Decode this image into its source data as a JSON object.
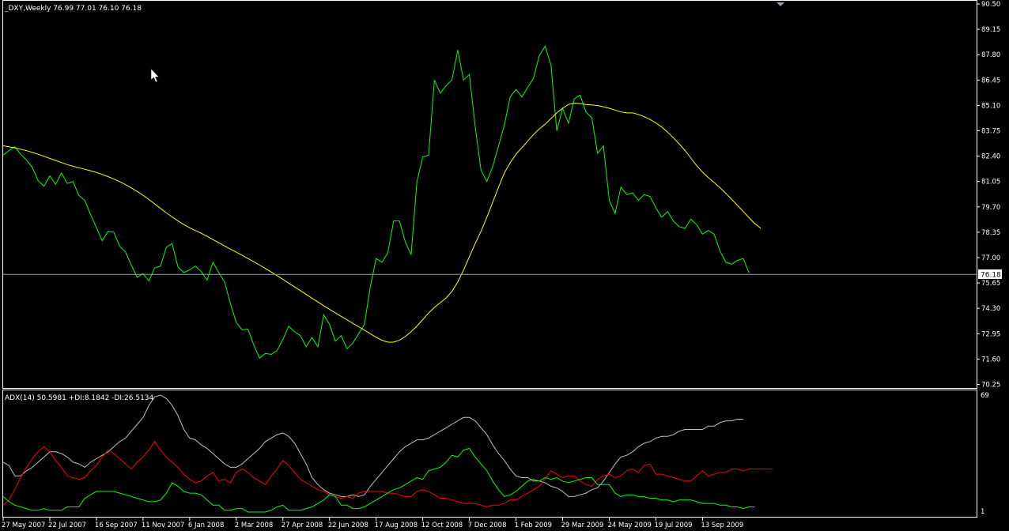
{
  "main_header": "_DXY,Weekly  76.99 77.01 76.10 76.18",
  "sub_header": "ADX(14) 50.5981 +DI:8.1842 -DI:26.5134",
  "current_price_label": "76.18",
  "current_price": 76.18,
  "colors": {
    "background": "#000000",
    "price": "#00ff00",
    "ma": "#ffff00",
    "adx": "#c0c0c0",
    "plus_di": "#00ff00",
    "minus_di": "#ff0000",
    "axis": "#ffffff",
    "price_line": "#8ea0b4"
  },
  "chart_data": [
    {
      "type": "line",
      "title": "_DXY,Weekly",
      "ylim": [
        70.25,
        90.5
      ],
      "y_ticks": [
        "90.50",
        "89.15",
        "87.80",
        "86.45",
        "85.10",
        "83.75",
        "82.40",
        "81.05",
        "79.70",
        "78.35",
        "77.00",
        "75.65",
        "74.30",
        "72.95",
        "71.60",
        "70.25"
      ],
      "series": [
        {
          "name": "_DXY",
          "values": [
            82.45,
            82.7,
            82.9,
            82.5,
            82.2,
            81.8,
            81.1,
            80.8,
            81.35,
            80.9,
            81.5,
            80.95,
            81.05,
            80.3,
            80.05,
            79.3,
            78.6,
            77.9,
            78.4,
            78.35,
            77.6,
            77.3,
            76.6,
            75.95,
            76.15,
            75.75,
            76.45,
            76.55,
            77.55,
            77.75,
            76.5,
            76.2,
            76.35,
            76.55,
            76.25,
            75.8,
            76.75,
            76.2,
            75.7,
            74.55,
            73.55,
            73.15,
            73.2,
            72.35,
            71.65,
            71.9,
            71.85,
            72.05,
            72.65,
            73.35,
            73.05,
            72.85,
            72.25,
            72.75,
            72.25,
            73.95,
            73.45,
            72.55,
            72.85,
            72.15,
            72.45,
            72.95,
            73.45,
            75.45,
            76.95,
            76.75,
            77.25,
            78.95,
            78.95,
            77.85,
            77.15,
            81.05,
            82.35,
            82.45,
            86.45,
            85.75,
            86.15,
            86.45,
            88.05,
            86.45,
            86.75,
            83.95,
            81.65,
            81.05,
            81.85,
            82.95,
            84.05,
            85.55,
            85.95,
            85.55,
            86.05,
            86.55,
            87.75,
            88.25,
            87.25,
            83.75,
            84.95,
            84.15,
            85.45,
            85.65,
            84.75,
            84.45,
            82.55,
            82.95,
            80.05,
            79.35,
            80.75,
            80.35,
            80.45,
            80.05,
            80.35,
            80.25,
            79.65,
            79.15,
            79.45,
            78.95,
            78.65,
            78.55,
            79.05,
            78.75,
            78.25,
            78.45,
            78.25,
            77.35,
            76.75,
            76.65,
            76.85,
            76.95,
            76.18
          ]
        },
        {
          "name": "MA",
          "values": [
            82.95,
            82.9,
            82.84,
            82.77,
            82.69,
            82.6,
            82.5,
            82.39,
            82.28,
            82.17,
            82.06,
            81.95,
            81.86,
            81.78,
            81.7,
            81.62,
            81.53,
            81.43,
            81.31,
            81.18,
            81.04,
            80.88,
            80.71,
            80.52,
            80.32,
            80.09,
            79.86,
            79.62,
            79.38,
            79.16,
            78.95,
            78.76,
            78.59,
            78.44,
            78.29,
            78.13,
            77.96,
            77.79,
            77.62,
            77.45,
            77.29,
            77.12,
            76.95,
            76.78,
            76.6,
            76.42,
            76.23,
            76.04,
            75.84,
            75.64,
            75.44,
            75.24,
            75.04,
            74.84,
            74.64,
            74.44,
            74.25,
            74.06,
            73.87,
            73.69,
            73.5,
            73.32,
            73.14,
            72.95,
            72.76,
            72.6,
            72.5,
            72.5,
            72.6,
            72.8,
            73.06,
            73.36,
            73.7,
            74.05,
            74.35,
            74.6,
            74.85,
            75.2,
            75.7,
            76.33,
            77.05,
            77.75,
            78.4,
            79.15,
            79.95,
            80.75,
            81.5,
            82.05,
            82.5,
            82.85,
            83.2,
            83.55,
            83.85,
            84.1,
            84.4,
            84.7,
            84.95,
            85.15,
            85.22,
            85.2,
            85.15,
            85.12,
            85.09,
            85.03,
            84.95,
            84.85,
            84.75,
            84.7,
            84.7,
            84.62,
            84.5,
            84.35,
            84.17,
            83.95,
            83.68,
            83.38,
            83.05,
            82.7,
            82.3,
            81.9,
            81.55,
            81.25,
            81.0,
            80.72,
            80.42,
            80.1,
            79.78,
            79.45,
            79.12,
            78.8,
            78.56
          ]
        }
      ]
    },
    {
      "type": "line",
      "title": "ADX(14)",
      "ylim": [
        1,
        69
      ],
      "y_ticks": [
        "69",
        "1"
      ],
      "series": [
        {
          "name": "ADX",
          "values": [
            30,
            28,
            22,
            22,
            25,
            27,
            30,
            33,
            36,
            36,
            35,
            33,
            30,
            29,
            27,
            30,
            32,
            34,
            36,
            39,
            42,
            44,
            48,
            52,
            56,
            63,
            68,
            69,
            67,
            63,
            57,
            49,
            44,
            43,
            40,
            38,
            35,
            32,
            29,
            27,
            27,
            29,
            32,
            35,
            38,
            42,
            44,
            46,
            47,
            45,
            41,
            35,
            29,
            21,
            17,
            14,
            12,
            11,
            10,
            10,
            11,
            10,
            11,
            16,
            20,
            24,
            28,
            32,
            36,
            39,
            41,
            43,
            43,
            44,
            46,
            48,
            50,
            52,
            54,
            56,
            56,
            54,
            50,
            46,
            40,
            35,
            31,
            26,
            22,
            21,
            21,
            19,
            19,
            18,
            16,
            15,
            13,
            10,
            10,
            11,
            12,
            14,
            15,
            19,
            24,
            29,
            33,
            34,
            36,
            39,
            41,
            42,
            44,
            45,
            45,
            46,
            48,
            49,
            49,
            49,
            49,
            51,
            51,
            53,
            54,
            54,
            55,
            55
          ],
          "start": 0
        },
        {
          "name": "+DI",
          "values": [
            10,
            7,
            5,
            4,
            3,
            2,
            2,
            3,
            2,
            2,
            2,
            4,
            4,
            4,
            9,
            11,
            13,
            13,
            13,
            13,
            12,
            11,
            10,
            9,
            8,
            7,
            7,
            8,
            12,
            18,
            16,
            13,
            12,
            12,
            11,
            8,
            5,
            5,
            2,
            2,
            3,
            3,
            1,
            1,
            1,
            1,
            2,
            4,
            5,
            2,
            2,
            2,
            3,
            4,
            6,
            8,
            11,
            10,
            5,
            5,
            3,
            3,
            4,
            6,
            8,
            10,
            12,
            14,
            15,
            17,
            19,
            21,
            20,
            25,
            26,
            27,
            30,
            34,
            33,
            37,
            38,
            33,
            29,
            25,
            19,
            14,
            10,
            11,
            13,
            16,
            19,
            20,
            19,
            21,
            20,
            21,
            19,
            18,
            19,
            20,
            21,
            21,
            17,
            17,
            17,
            12,
            10,
            11,
            11,
            10,
            10,
            9,
            9,
            8,
            8,
            7,
            8,
            8,
            8,
            7,
            6,
            6,
            6,
            5,
            5,
            4,
            4,
            3,
            4,
            4
          ],
          "start": 0
        },
        {
          "name": "-DI",
          "values": [
            5,
            8,
            14,
            21,
            27,
            32,
            36,
            39,
            36,
            31,
            27,
            22,
            21,
            20,
            21,
            25,
            28,
            33,
            37,
            35,
            32,
            29,
            26,
            30,
            33,
            37,
            42,
            37,
            33,
            30,
            27,
            23,
            20,
            18,
            19,
            22,
            24,
            19,
            20,
            18,
            24,
            26,
            24,
            21,
            19,
            17,
            22,
            26,
            31,
            28,
            24,
            20,
            18,
            16,
            14,
            13,
            11,
            10,
            9,
            10,
            9,
            12,
            13,
            13,
            13,
            13,
            12,
            12,
            11,
            10,
            10,
            13,
            14,
            13,
            11,
            9,
            9,
            8,
            7,
            6,
            6,
            6,
            5,
            4,
            5,
            5,
            6,
            8,
            8,
            10,
            12,
            14,
            16,
            20,
            25,
            23,
            21,
            22,
            22,
            19,
            17,
            16,
            20,
            22,
            23,
            21,
            22,
            25,
            26,
            24,
            28,
            29,
            23,
            23,
            22,
            21,
            20,
            19,
            19,
            22,
            25,
            22,
            23,
            24,
            24,
            26,
            26,
            25,
            26,
            26,
            26,
            26,
            26
          ],
          "start": 0
        }
      ]
    }
  ],
  "x_axis": {
    "tick_labels": [
      "27 May 2007",
      "22 Jul 2007",
      "16 Sep 2007",
      "11 Nov 2007",
      "6 Jan 2008",
      "2 Mar 2008",
      "27 Apr 2008",
      "22 Jun 2008",
      "17 Aug 2008",
      "12 Oct 2008",
      "7 Dec 2008",
      "1 Feb 2009",
      "29 Mar 2009",
      "24 May 2009",
      "19 Jul 2009",
      "13 Sep 2009"
    ]
  }
}
